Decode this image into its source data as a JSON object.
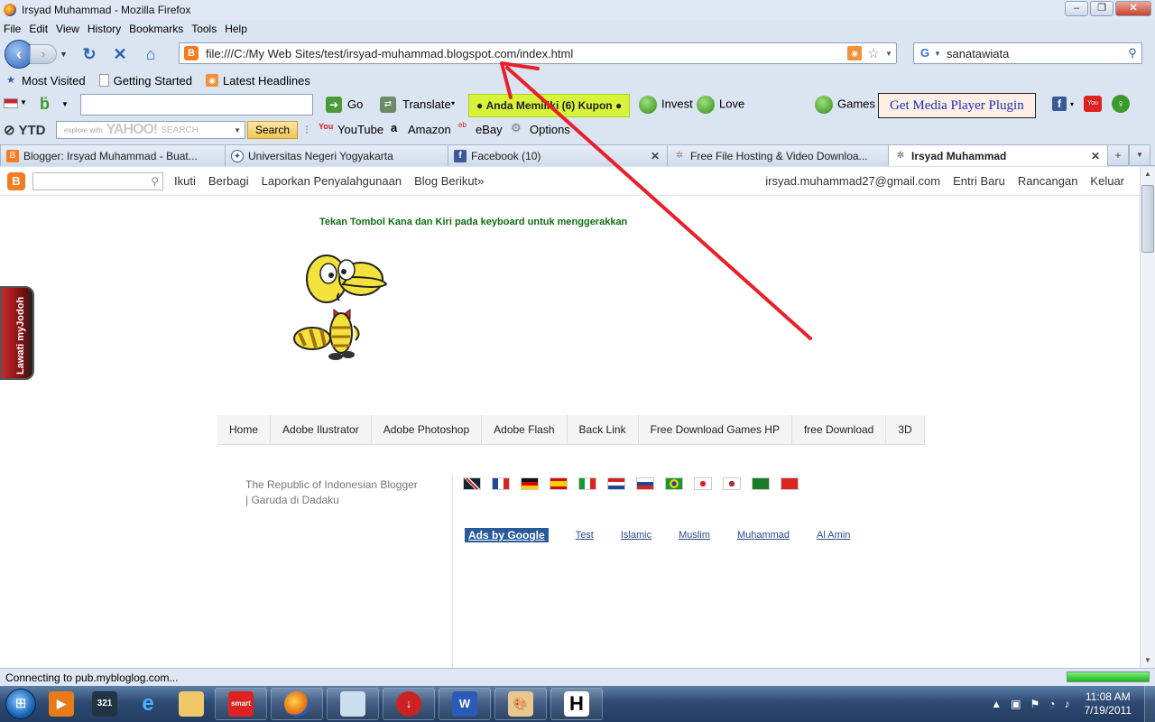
{
  "window": {
    "title": "Irsyad Muhammad - Mozilla Firefox"
  },
  "menu": [
    "File",
    "Edit",
    "View",
    "History",
    "Bookmarks",
    "Tools",
    "Help"
  ],
  "nav": {
    "url": "file:///C:/My Web Sites/test/irsyad-muhammad.blogspot.com/index.html",
    "search_value": "sanatawiata"
  },
  "bookmarks": [
    "Most Visited",
    "Getting Started",
    "Latest Headlines"
  ],
  "toolbar1": {
    "go": "Go",
    "translate": "Translate",
    "coupon": "Anda Memiliki (6) Kupon",
    "invest": "Invest",
    "love": "Love",
    "games": "Games",
    "media_plugin": "Get Media Player Plugin"
  },
  "toolbar2": {
    "ytd": "YTD",
    "yahoo_hint": "explore with",
    "yahoo_brand": "YAHOO!",
    "yahoo_search_word": "SEARCH",
    "search_btn": "Search",
    "youtube": "YouTube",
    "amazon": "Amazon",
    "ebay": "eBay",
    "options": "Options"
  },
  "tabs": [
    {
      "label": "Blogger: Irsyad Muhammad - Buat...",
      "active": false
    },
    {
      "label": "Universitas Negeri Yogyakarta",
      "active": false
    },
    {
      "label": "Facebook (10)",
      "active": false
    },
    {
      "label": "Free File Hosting & Video Downloa...",
      "active": false
    },
    {
      "label": "Irsyad Muhammad",
      "active": true
    }
  ],
  "blogger": {
    "links": [
      "Ikuti",
      "Berbagi",
      "Laporkan Penyalahgunaan",
      "Blog Berikut»"
    ],
    "email": "irsyad.muhammad27@gmail.com",
    "right_links": [
      "Entri Baru",
      "Rancangan",
      "Keluar"
    ]
  },
  "page": {
    "instruction": "Tekan Tombol Kana dan Kiri pada keyboard untuk menggerakkan",
    "side_badge": "Lawati myJodoh",
    "nav_menu": [
      "Home",
      "Adobe Ilustrator",
      "Adobe Photoshop",
      "Adobe Flash",
      "Back Link",
      "Free Download Games HP",
      "free Download",
      "3D"
    ],
    "republic_line1": "The Republic of Indonesian Blogger",
    "republic_line2": "| Garuda di Dadaku",
    "ads_label": "Ads by Google",
    "ad_links": [
      "Test",
      "Islamic",
      "Muslim",
      "Muhammad",
      "Al Amin"
    ]
  },
  "status": {
    "text": "Connecting to pub.mybloglog.com...",
    "progress": 1.0
  },
  "taskbar": {
    "time": "11:08 AM",
    "date": "7/19/2011"
  }
}
